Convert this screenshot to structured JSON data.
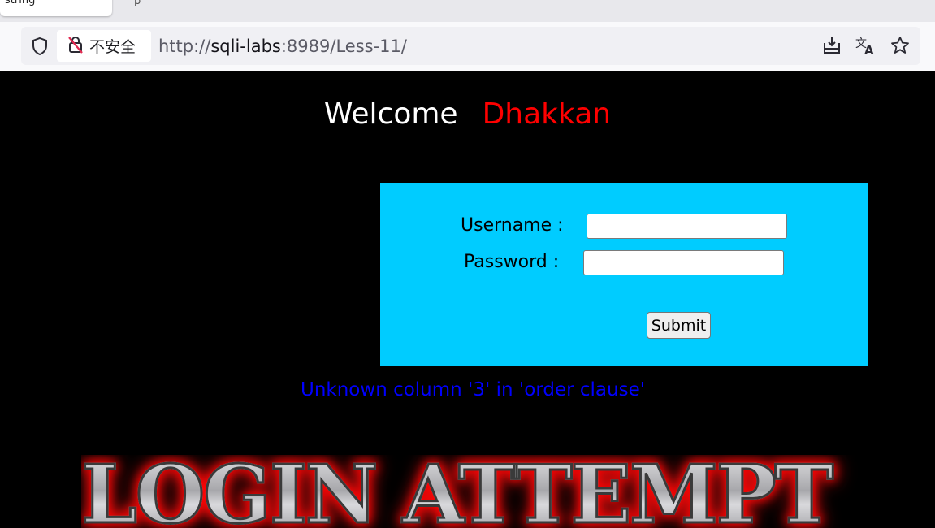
{
  "browser": {
    "active_tab_title": "string",
    "next_tab_title": "p",
    "security_label": "不安全",
    "url_scheme": "http://",
    "url_host": "sqli-labs",
    "url_rest": ":8989/Less-11/",
    "icons": [
      "shield-icon",
      "insecure-lock-icon",
      "download-icon",
      "translate-icon",
      "bookmark-star-icon"
    ]
  },
  "page": {
    "welcome_label": "Welcome",
    "welcome_name": "Dhakkan",
    "form": {
      "username_label": "Username :",
      "password_label": "Password :",
      "username_value": "",
      "password_value": "",
      "submit_label": "Submit"
    },
    "error_message": "Unknown column '3' in 'order clause'",
    "banner_text": "LOGIN ATTEMPT"
  },
  "colors": {
    "page_bg": "#000000",
    "form_bg": "#00ccff",
    "welcome_name": "#ff0000",
    "error_text": "#0000ff"
  }
}
